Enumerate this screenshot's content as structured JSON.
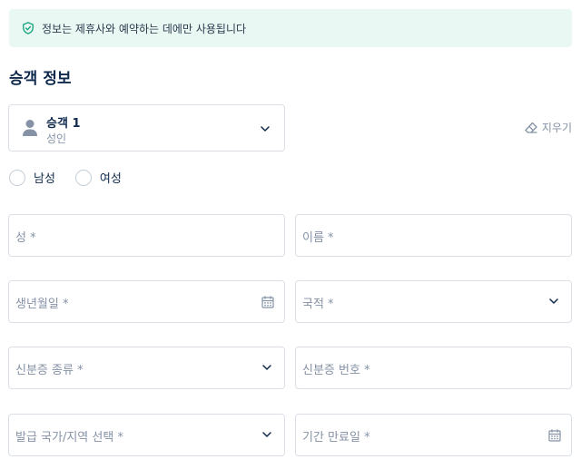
{
  "notice": {
    "text": "정보는 제휴사와 예약하는 데에만 사용됩니다",
    "icon": "shield-check-icon",
    "color": "#e9f8f3"
  },
  "section": {
    "title": "승객 정보"
  },
  "passenger": {
    "name": "승객 1",
    "type": "성인",
    "icon": "person-icon"
  },
  "clear": {
    "label": "지우기",
    "icon": "eraser-icon"
  },
  "gender": {
    "options": [
      "남성",
      "여성"
    ]
  },
  "fields": {
    "last_name": "성 *",
    "first_name": "이름 *",
    "birth_date": "생년월일 *",
    "nationality": "국적 *",
    "id_type": "신분증 종류 *",
    "id_number": "신분증 번호 *",
    "issuing_country": "발급 국가/지역 선택 *",
    "expiry_date": "기간 만료일 *"
  }
}
